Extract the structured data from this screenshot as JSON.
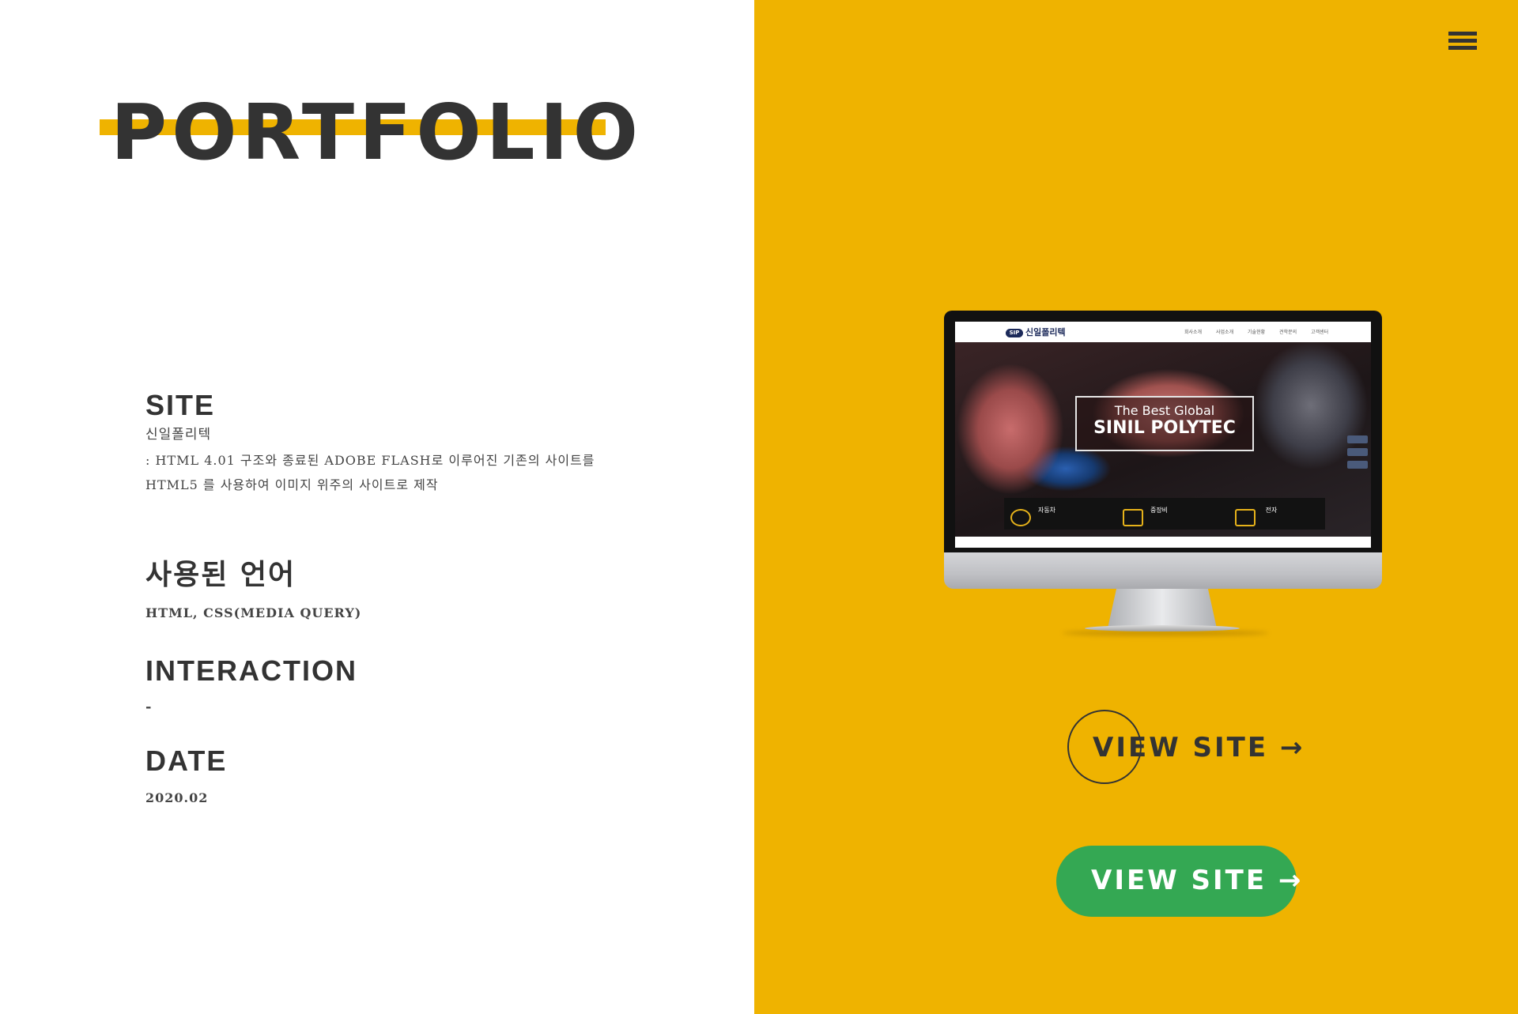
{
  "header": {
    "title": "PORTFOLIO"
  },
  "menu": {
    "icon": "hamburger-menu-icon"
  },
  "info": {
    "site_heading": "SITE",
    "site_name": "신일폴리텍",
    "site_desc_line1": ": HTML 4.01 구조와 종료된 ADOBE FLASH로 이루어진 기존의 사이트를",
    "site_desc_line2": "HTML5 를 사용하여 이미지 위주의 사이트로 제작",
    "lang_heading": "사용된 언어",
    "lang_value": "HTML, CSS(MEDIA QUERY)",
    "interaction_heading": "INTERACTION",
    "interaction_value": "-",
    "date_heading": "DATE",
    "date_value": "2020.02"
  },
  "preview": {
    "logo_badge": "SIP",
    "logo_text": "신일폴리텍",
    "nav": [
      "회사소개",
      "사업소개",
      "기술현황",
      "견학문의",
      "고객센터"
    ],
    "hero_line1": "The Best Global",
    "hero_line2": "SINIL POLYTEC",
    "categories": [
      "자동차",
      "중장비",
      "전자"
    ]
  },
  "buttons": {
    "view_site_outline": "VIEW SITE →",
    "view_site_filled": "VIEW SITE →"
  },
  "colors": {
    "accent": "#efb300",
    "text": "#333333",
    "button_green": "#34a853"
  }
}
